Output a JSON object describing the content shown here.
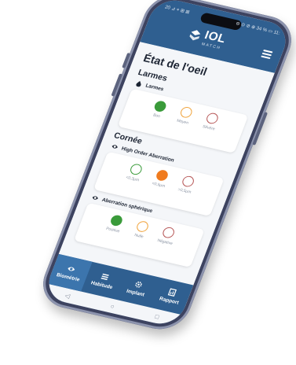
{
  "status": {
    "left": "20 ⊿ ⌖ ⊞ ⊠",
    "right": "⊖ ⊙ ⊘ ⊕ 34 % ▭ 11:"
  },
  "header": {
    "logo_text": "IOL",
    "logo_sub": "MATCH"
  },
  "page": {
    "title": "État de l'oeil"
  },
  "sections": [
    {
      "title": "Larmes",
      "items": [
        {
          "label": "Larmes",
          "icon": "drop-icon",
          "options": [
            {
              "label": "Bon",
              "color": "#3a9b3a",
              "filled": true
            },
            {
              "label": "Moyen",
              "color": "#f0a33b",
              "filled": false
            },
            {
              "label": "Sévère",
              "color": "#b65656",
              "filled": false
            }
          ]
        }
      ]
    },
    {
      "title": "Cornée",
      "items": [
        {
          "label": "High Order Aberration",
          "icon": "eye-icon",
          "options": [
            {
              "label": "<0,3µm",
              "color": "#3a9b3a",
              "filled": false
            },
            {
              "label": "<0,5µm",
              "color": "#f07b1e",
              "filled": true
            },
            {
              "label": ">0,5µm",
              "color": "#b65656",
              "filled": false
            }
          ]
        },
        {
          "label": "Aberration sphérique",
          "icon": "eye-icon",
          "options": [
            {
              "label": "Positive",
              "color": "#3a9b3a",
              "filled": true
            },
            {
              "label": "Nulle",
              "color": "#f0a33b",
              "filled": false
            },
            {
              "label": "Négative",
              "color": "#b65656",
              "filled": false
            }
          ]
        }
      ]
    }
  ],
  "bottom_nav": [
    {
      "label": "Biométrie",
      "icon": "eye-icon",
      "active": true
    },
    {
      "label": "Habitude",
      "icon": "list-icon",
      "active": false
    },
    {
      "label": "Implant",
      "icon": "gear-icon",
      "active": false
    },
    {
      "label": "Rapport",
      "icon": "report-icon",
      "active": false
    }
  ],
  "system_nav": {
    "back": "◁",
    "home": "○",
    "recent": "□"
  }
}
